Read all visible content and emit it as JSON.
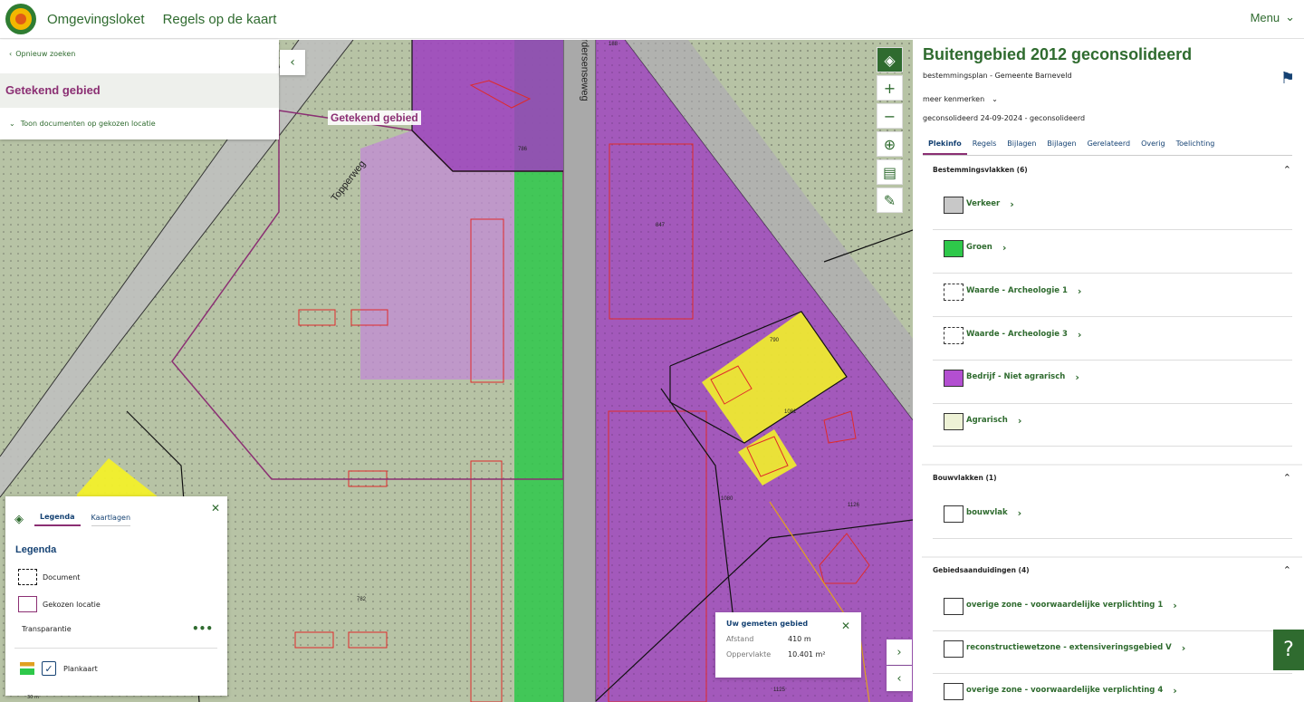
{
  "header": {
    "brand": "Omgevingsloket",
    "nav_title": "Regels op de kaart",
    "menu_label": "Menu"
  },
  "left_panel": {
    "back_label": "Opnieuw zoeken",
    "title": "Getekend gebied",
    "toon_label": "Toon documenten op gekozen locatie"
  },
  "map": {
    "area_label": "Getekend gebied",
    "road_1": "Topperweg",
    "road_2": "ardersenseweg",
    "numbers": [
      "188",
      "786",
      "847",
      "790",
      "1081",
      "1080",
      "1126",
      "782",
      "1125"
    ]
  },
  "measure": {
    "title": "Uw gemeten gebied",
    "distance_label": "Afstand",
    "distance_value": "410 m",
    "area_label": "Oppervlakte",
    "area_value": "10.401 m²"
  },
  "legend": {
    "tab_active": "Legenda",
    "tab_other": "Kaartlagen",
    "heading": "Legenda",
    "items": [
      "Document",
      "Gekozen locatie"
    ],
    "transparency_label": "Transparantie",
    "plankaart_label": "Plankaart"
  },
  "scale_text": "30 m",
  "plan": {
    "title": "Buitengebied 2012 geconsolideerd",
    "subtitle": "bestemmingsplan - Gemeente Barneveld",
    "meer_label": "meer kenmerken",
    "status": "geconsolideerd 24-09-2024 - geconsolideerd",
    "tabs": [
      "Plekinfo",
      "Regels",
      "Bijlagen",
      "Bijlagen",
      "Gerelateerd",
      "Overig",
      "Toelichting"
    ],
    "sections": [
      {
        "heading": "Bestemmingsvlakken (6)",
        "items": [
          {
            "name": "Verkeer",
            "color": "#c8c8c8"
          },
          {
            "name": "Groen",
            "color": "#2ec84a"
          },
          {
            "name": "Waarde - Archeologie 1",
            "color": "#ffffff"
          },
          {
            "name": "Waarde - Archeologie 3",
            "color": "#ffffff"
          },
          {
            "name": "Bedrijf - Niet agrarisch",
            "color": "#b34fd1"
          },
          {
            "name": "Agrarisch",
            "color": "#eef2d6"
          }
        ]
      },
      {
        "heading": "Bouwvlakken (1)",
        "items": [
          {
            "name": "bouwvlak",
            "color": "#ffffff"
          }
        ]
      },
      {
        "heading": "Gebiedsaanduidingen (4)",
        "items": [
          {
            "name": "overige zone - voorwaardelijke verplichting 1",
            "color": "#ffffff"
          },
          {
            "name": "reconstructiewetzone - extensiveringsgebied V",
            "color": "#ffffff"
          },
          {
            "name": "overige zone - voorwaardelijke verplichting 4",
            "color": "#ffffff"
          }
        ]
      }
    ]
  },
  "colors": {
    "brand_green": "#2f6b2f",
    "accent_purple": "#8b2f73",
    "purple_zone": "#9d3fc0",
    "yellow_zone": "#f2f02a",
    "green_zone": "#2ec84a"
  }
}
